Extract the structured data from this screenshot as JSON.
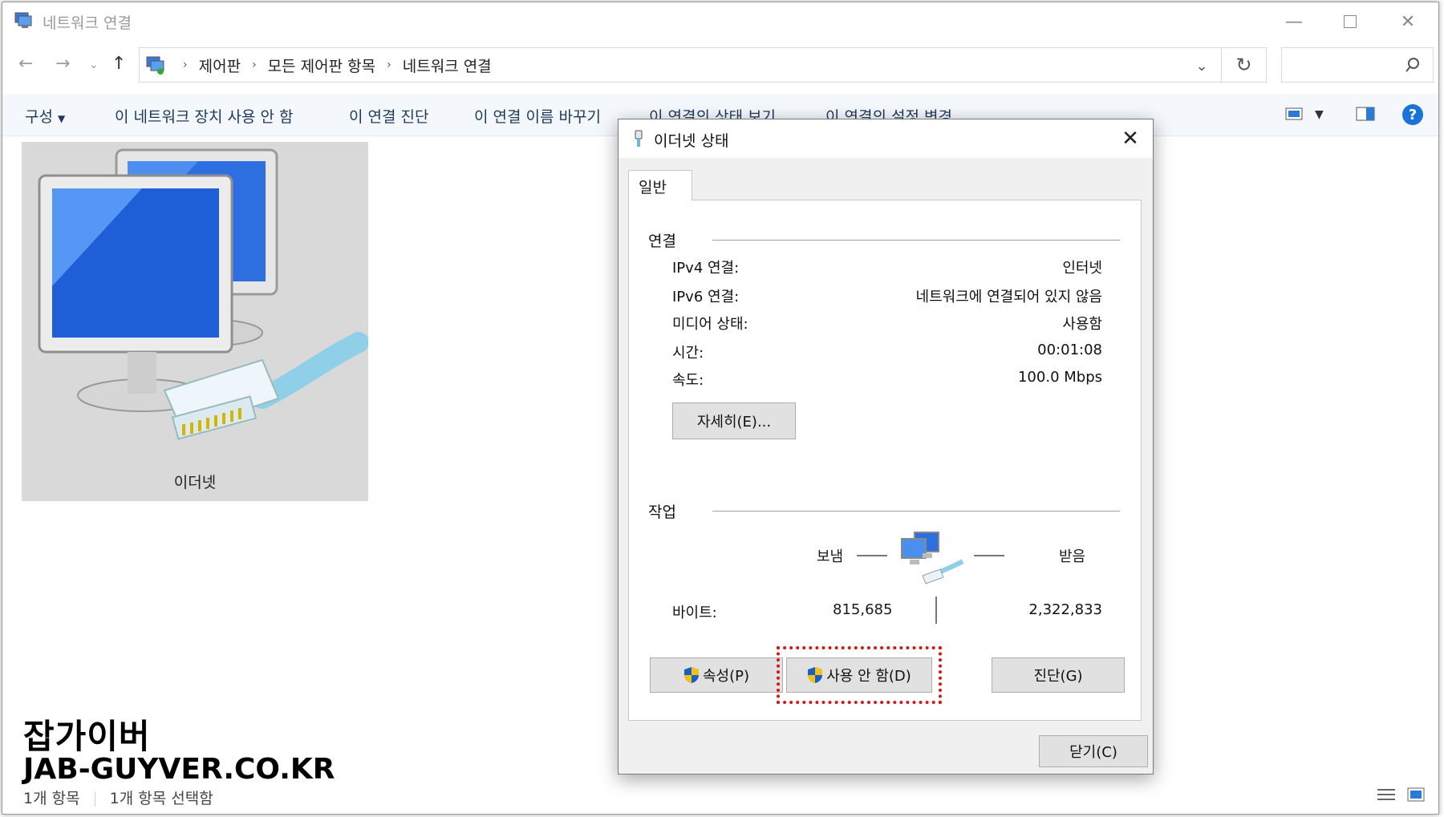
{
  "window": {
    "title": "네트워크 연결"
  },
  "address": {
    "crumbs": [
      "제어판",
      "모든 제어판 항목",
      "네트워크 연결"
    ],
    "search_placeholder": ""
  },
  "commands": [
    "구성",
    "이 네트워크 장치 사용 안 함",
    "이 연결 진단",
    "이 연결 이름 바꾸기",
    "이 연결의 상태 보기",
    "이 연결의 설정 변경"
  ],
  "item": {
    "label": "이더넷"
  },
  "status": {
    "count": "1개 항목",
    "selected": "1개 항목 선택함"
  },
  "dialog": {
    "title": "이더넷 상태",
    "tab": "일반",
    "connection_section": "연결",
    "rows": [
      {
        "label": "IPv4 연결:",
        "value": "인터넷"
      },
      {
        "label": "IPv6 연결:",
        "value": "네트워크에 연결되어 있지 않음"
      },
      {
        "label": "미디어 상태:",
        "value": "사용함"
      },
      {
        "label": "시간:",
        "value": "00:01:08"
      },
      {
        "label": "속도:",
        "value": "100.0 Mbps"
      }
    ],
    "details_button": "자세히(E)...",
    "activity_section": "작업",
    "sent_label": "보냄",
    "received_label": "받음",
    "bytes_label": "바이트:",
    "bytes_sent": "815,685",
    "bytes_received": "2,322,833",
    "properties_button": "속성(P)",
    "disable_button": "사용 안 함(D)",
    "diagnose_button": "진단(G)",
    "close_button": "닫기(C)"
  },
  "watermark": {
    "line1": "잡가이버",
    "line2": "JAB-GUYVER.CO.KR"
  },
  "colors": {
    "highlight": "#d01818",
    "command_text": "#1e395b",
    "help_blue": "#1a73d9"
  }
}
